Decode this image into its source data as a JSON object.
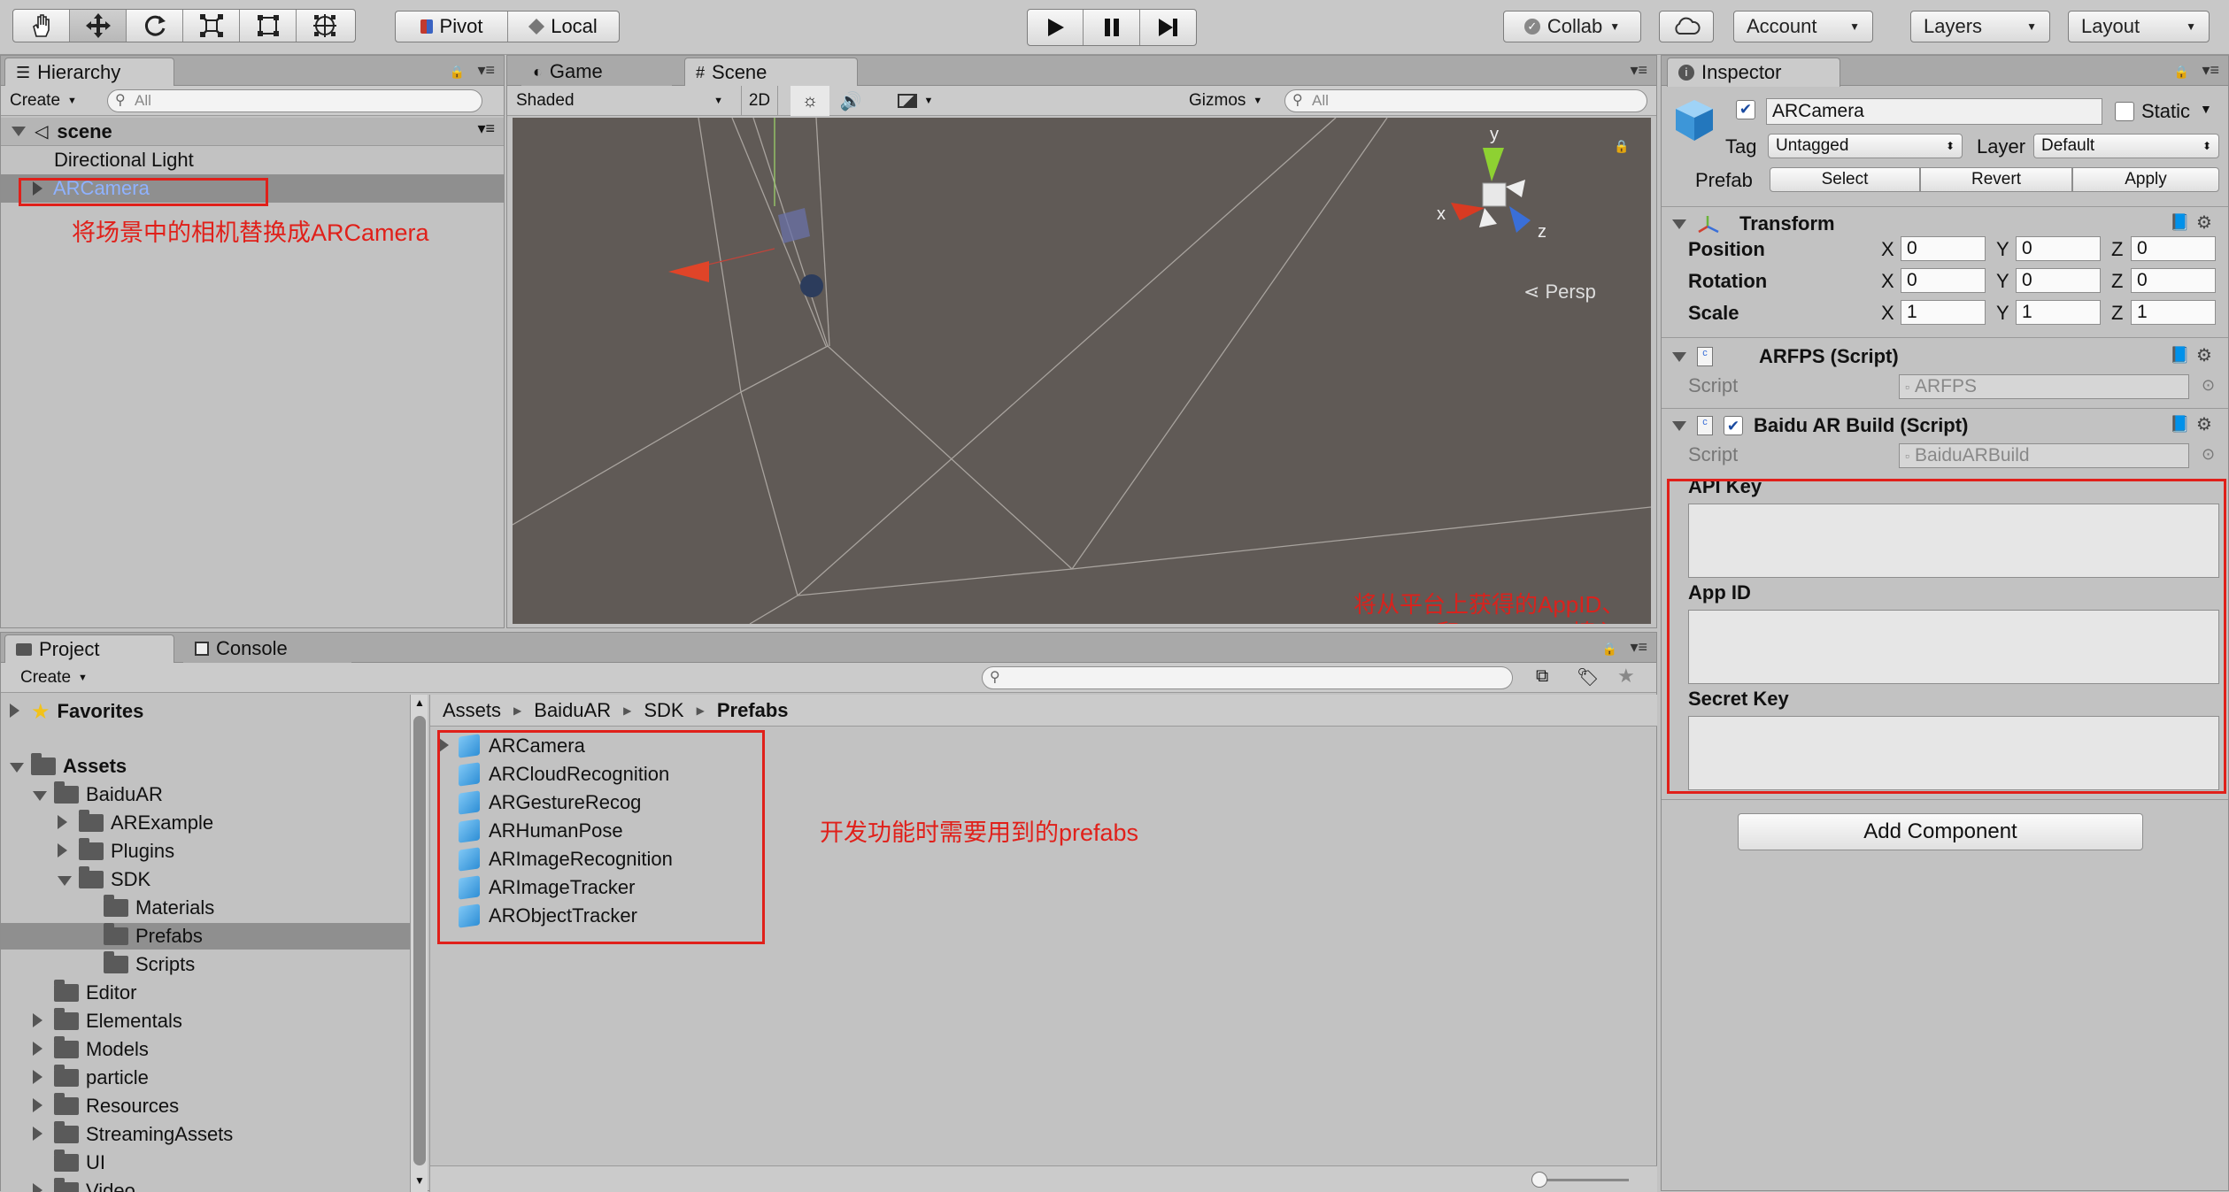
{
  "toolbar": {
    "pivot": "Pivot",
    "local": "Local",
    "collab": "Collab",
    "account": "Account",
    "layers": "Layers",
    "layout": "Layout"
  },
  "hierarchy": {
    "tab": "Hierarchy",
    "create": "Create",
    "search_placeholder": "All",
    "scene": "scene",
    "items": [
      "Directional Light",
      "ARCamera"
    ],
    "annotation": "将场景中的相机替换成ARCamera"
  },
  "scene_view": {
    "tabs": [
      "Game",
      "Scene"
    ],
    "shading": "Shaded",
    "mode2d": "2D",
    "gizmos": "Gizmos",
    "search_placeholder": "All",
    "persp": "Persp",
    "axis_y": "y",
    "axis_x": "x",
    "axis_z": "z",
    "annotation": "将从平台上获得的AppID、API Key和Secret Key填入进去"
  },
  "inspector": {
    "tab": "Inspector",
    "object_name": "ARCamera",
    "static": "Static",
    "tag_label": "Tag",
    "tag_value": "Untagged",
    "layer_label": "Layer",
    "layer_value": "Default",
    "prefab_label": "Prefab",
    "prefab_buttons": [
      "Select",
      "Revert",
      "Apply"
    ],
    "transform": {
      "title": "Transform",
      "rows": [
        {
          "label": "Position",
          "x": "0",
          "y": "0",
          "z": "0"
        },
        {
          "label": "Rotation",
          "x": "0",
          "y": "0",
          "z": "0"
        },
        {
          "label": "Scale",
          "x": "1",
          "y": "1",
          "z": "1"
        }
      ],
      "axes": [
        "X",
        "Y",
        "Z"
      ]
    },
    "arfps": {
      "title": "ARFPS (Script)",
      "script_label": "Script",
      "script_value": "ARFPS"
    },
    "baidu": {
      "title": "Baidu AR Build (Script)",
      "script_label": "Script",
      "script_value": "BaiduARBuild",
      "fields": [
        "API Key",
        "App ID",
        "Secret Key"
      ]
    },
    "add_component": "Add Component"
  },
  "project": {
    "tabs": [
      "Project",
      "Console"
    ],
    "create": "Create",
    "favorites": "Favorites",
    "tree": [
      "Assets",
      "BaiduAR",
      "ARExample",
      "Plugins",
      "SDK",
      "Materials",
      "Prefabs",
      "Scripts",
      "Editor",
      "Elementals",
      "Models",
      "particle",
      "Resources",
      "StreamingAssets",
      "UI",
      "Video"
    ],
    "breadcrumb": [
      "Assets",
      "BaiduAR",
      "SDK",
      "Prefabs"
    ],
    "prefabs": [
      "ARCamera",
      "ARCloudRecognition",
      "ARGestureRecog",
      "ARHumanPose",
      "ARImageRecognition",
      "ARImageTracker",
      "ARObjectTracker"
    ],
    "annotation": "开发功能时需要用到的prefabs"
  }
}
